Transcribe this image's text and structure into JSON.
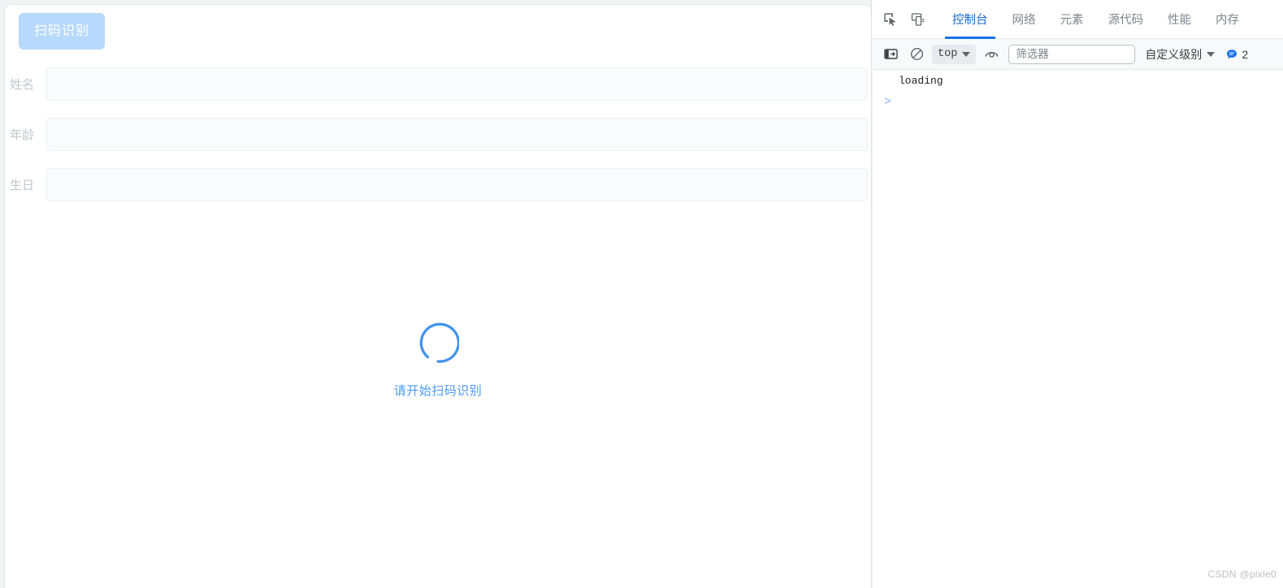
{
  "page": {
    "scan_button_label": "扫码识别",
    "form_fields": [
      {
        "label": "姓名",
        "value": "",
        "placeholder": ""
      },
      {
        "label": "年龄",
        "value": "",
        "placeholder": ""
      },
      {
        "label": "生日",
        "value": "",
        "placeholder": ""
      }
    ],
    "scan_status_text": "请开始扫码识别",
    "accent_color": "#4a9af5",
    "button_color": "#b7d9fc"
  },
  "devtools": {
    "icons": {
      "inspect": "inspect-element-icon",
      "device": "device-toolbar-icon"
    },
    "tabs": [
      {
        "label": "控制台",
        "active": true
      },
      {
        "label": "网络",
        "active": false
      },
      {
        "label": "元素",
        "active": false
      },
      {
        "label": "源代码",
        "active": false
      },
      {
        "label": "性能",
        "active": false
      },
      {
        "label": "内存",
        "active": false
      }
    ],
    "toolbar": {
      "sidebar_toggle": "console-sidebar-icon",
      "clear_console": "clear-console-icon",
      "context_value": "top",
      "live_expression": "eye-icon",
      "filter_placeholder": "筛选器",
      "filter_value": "",
      "level_label": "自定义级别",
      "message_count": "2",
      "badge_color": "#1a73e8"
    },
    "console": {
      "messages": [
        {
          "text": "loading"
        }
      ],
      "prompt_symbol": ">"
    },
    "active_tab_color": "#1967d2"
  },
  "watermark": "CSDN @pixle0"
}
